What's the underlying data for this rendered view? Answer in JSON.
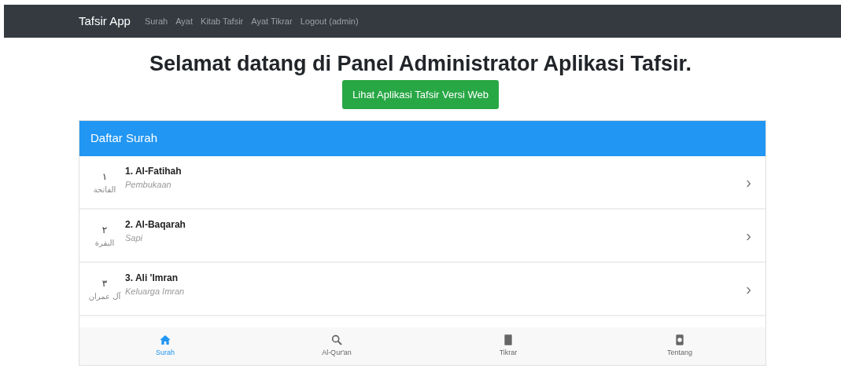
{
  "navbar": {
    "brand": "Tafsir App",
    "links": [
      {
        "label": "Surah"
      },
      {
        "label": "Ayat"
      },
      {
        "label": "Kitab Tafsir"
      },
      {
        "label": "Ayat Tikrar"
      },
      {
        "label": "Logout (admin)"
      }
    ]
  },
  "heading": "Selamat datang di Panel Administrator Aplikasi Tafsir.",
  "web_button": "Lihat Aplikasi Tafsir Versi Web",
  "card": {
    "title": "Daftar Surah",
    "rows": [
      {
        "number": "١",
        "arabic": "الفاتحة",
        "name": "1. Al-Fatihah",
        "meaning": "Pembukaan",
        "chevron": "›"
      },
      {
        "number": "٢",
        "arabic": "البقرة",
        "name": "2. Al-Baqarah",
        "meaning": "Sapi",
        "chevron": "›"
      },
      {
        "number": "٣",
        "arabic": "آل عمران",
        "name": "3. Ali 'Imran",
        "meaning": "Keluarga Imran",
        "chevron": "›"
      }
    ]
  },
  "bottom_nav": [
    {
      "label": "Surah",
      "kind": "home",
      "selected": true
    },
    {
      "label": "Al-Qur'an",
      "kind": "search",
      "selected": false
    },
    {
      "label": "Tikrar",
      "kind": "book",
      "selected": false
    },
    {
      "label": "Tentang",
      "kind": "info",
      "selected": false
    }
  ]
}
